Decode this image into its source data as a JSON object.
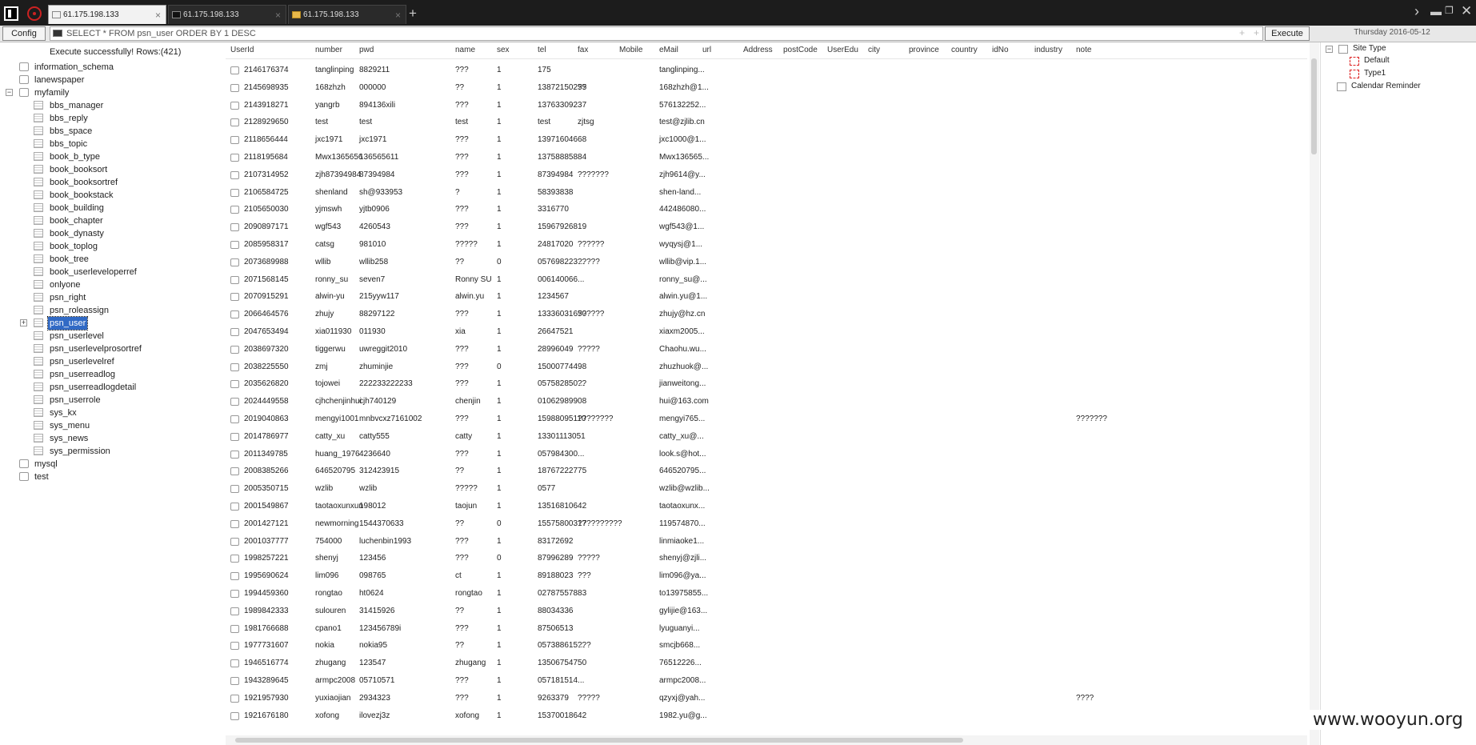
{
  "tabs": [
    {
      "label": "61.175.198.133",
      "active": true,
      "icon": "document-icon"
    },
    {
      "label": "61.175.198.133",
      "active": false,
      "icon": "terminal-icon"
    },
    {
      "label": "61.175.198.133",
      "active": false,
      "icon": "folder-icon"
    }
  ],
  "tab_close": "×",
  "tab_add": "+",
  "window": {
    "chevron": "›",
    "minimize": "▬",
    "maximize": "❐",
    "close": "✕"
  },
  "toolbar": {
    "config_label": "Config",
    "sql": "SELECT * FROM psn_user ORDER BY 1 DESC",
    "plus_label": "+",
    "execute_label": "Execute",
    "date": "Thursday 2016-05-12"
  },
  "status": "Execute successfully! Rows:(421)",
  "tree": {
    "databases_before": [
      "information_schema",
      "lanewspaper"
    ],
    "expanded_db": "myfamily",
    "tables": [
      "bbs_manager",
      "bbs_reply",
      "bbs_space",
      "bbs_topic",
      "book_b_type",
      "book_booksort",
      "book_booksortref",
      "book_bookstack",
      "book_building",
      "book_chapter",
      "book_dynasty",
      "book_toplog",
      "book_tree",
      "book_userleveloperref",
      "onlyone",
      "psn_right",
      "psn_roleassign",
      "psn_user",
      "psn_userlevel",
      "psn_userlevelprosortref",
      "psn_userlevelref",
      "psn_userreadlog",
      "psn_userreadlogdetail",
      "psn_userrole",
      "sys_kx",
      "sys_menu",
      "sys_news",
      "sys_permission"
    ],
    "selected_table": "psn_user",
    "databases_after": [
      "mysql",
      "test"
    ]
  },
  "grid": {
    "columns": [
      "UserId",
      "number",
      "pwd",
      "name",
      "sex",
      "tel",
      "fax",
      "Mobile",
      "eMail",
      "url",
      "Address",
      "postCode",
      "UserEdu",
      "city",
      "province",
      "country",
      "idNo",
      "industry",
      "note"
    ],
    "rows": [
      [
        "2146176374",
        "tanglinping",
        "8829211",
        "???",
        "1",
        "175",
        "",
        "",
        "tanglinping...",
        "",
        "",
        "",
        "",
        "",
        "",
        "",
        "",
        "",
        ""
      ],
      [
        "2145698935",
        "168zhzh",
        "000000",
        "??",
        "1",
        "13872150255",
        "??",
        "",
        "168zhzh@1...",
        "",
        "",
        "",
        "",
        "",
        "",
        "",
        "",
        "",
        ""
      ],
      [
        "2143918271",
        "yangrb",
        "894136xili",
        "???",
        "1",
        "13763309237",
        "",
        "",
        "576132252...",
        "",
        "",
        "",
        "",
        "",
        "",
        "",
        "",
        "",
        ""
      ],
      [
        "2128929650",
        "test",
        "test",
        "test",
        "1",
        "test",
        "zjtsg",
        "",
        "test@zjlib.cn",
        "",
        "",
        "",
        "",
        "",
        "",
        "",
        "",
        "",
        ""
      ],
      [
        "2118656444",
        "jxc1971",
        "jxc1971",
        "???",
        "1",
        "13971604668",
        "",
        "",
        "jxc1000@1...",
        "",
        "",
        "",
        "",
        "",
        "",
        "",
        "",
        "",
        ""
      ],
      [
        "2118195684",
        "Mwx1365656",
        "136565611",
        "???",
        "1",
        "13758885884",
        "",
        "",
        "Mwx136565...",
        "",
        "",
        "",
        "",
        "",
        "",
        "",
        "",
        "",
        ""
      ],
      [
        "2107314952",
        "zjh87394984",
        "87394984",
        "???",
        "1",
        "87394984",
        "???????",
        "",
        "zjh9614@y...",
        "",
        "",
        "",
        "",
        "",
        "",
        "",
        "",
        "",
        ""
      ],
      [
        "2106584725",
        "shenland",
        "sh@933953",
        "?",
        "1",
        "58393838",
        "",
        "",
        "shen-land...",
        "",
        "",
        "",
        "",
        "",
        "",
        "",
        "",
        "",
        ""
      ],
      [
        "2105650030",
        "yjmswh",
        "yjtb0906",
        "???",
        "1",
        "3316770",
        "",
        "",
        "442486080...",
        "",
        "",
        "",
        "",
        "",
        "",
        "",
        "",
        "",
        ""
      ],
      [
        "2090897171",
        "wgf543",
        "4260543",
        "???",
        "1",
        "15967926819",
        "",
        "",
        "wgf543@1...",
        "",
        "",
        "",
        "",
        "",
        "",
        "",
        "",
        "",
        ""
      ],
      [
        "2085958317",
        "catsg",
        "981010",
        "?????",
        "1",
        "24817020",
        "??????",
        "",
        "wyqysj@1...",
        "",
        "",
        "",
        "",
        "",
        "",
        "",
        "",
        "",
        ""
      ],
      [
        "2073689988",
        "wllib",
        "wllib258",
        "??",
        "0",
        "057698223...",
        "?????",
        "",
        "wllib@vip.1...",
        "",
        "",
        "",
        "",
        "",
        "",
        "",
        "",
        "",
        ""
      ],
      [
        "2071568145",
        "ronny_su",
        "seven7",
        "Ronny SU",
        "1",
        "006140066...",
        "",
        "",
        "ronny_su@...",
        "",
        "",
        "",
        "",
        "",
        "",
        "",
        "",
        "",
        ""
      ],
      [
        "2070915291",
        "alwin-yu",
        "215yyw117",
        "alwin.yu",
        "1",
        "1234567",
        "",
        "",
        "alwin.yu@1...",
        "",
        "",
        "",
        "",
        "",
        "",
        "",
        "",
        "",
        ""
      ],
      [
        "2066464576",
        "zhujy",
        "88297122",
        "???",
        "1",
        "13336031650",
        "??????",
        "",
        "zhujy@hz.cn",
        "",
        "",
        "",
        "",
        "",
        "",
        "",
        "",
        "",
        ""
      ],
      [
        "2047653494",
        "xia011930",
        "011930",
        "xia",
        "1",
        "26647521",
        "",
        "",
        "xiaxm2005...",
        "",
        "",
        "",
        "",
        "",
        "",
        "",
        "",
        "",
        ""
      ],
      [
        "2038697320",
        "tiggerwu",
        "uwreggit2010",
        "???",
        "1",
        "28996049",
        "?????",
        "",
        "Chaohu.wu...",
        "",
        "",
        "",
        "",
        "",
        "",
        "",
        "",
        "",
        ""
      ],
      [
        "2038225550",
        "zmj",
        "zhuminjie",
        "???",
        "0",
        "15000774498",
        "",
        "",
        "zhuzhuok@...",
        "",
        "",
        "",
        "",
        "",
        "",
        "",
        "",
        "",
        ""
      ],
      [
        "2035626820",
        "tojowei",
        "222233222233",
        "???",
        "1",
        "057582850...",
        "??",
        "",
        "jianweitong...",
        "",
        "",
        "",
        "",
        "",
        "",
        "",
        "",
        "",
        ""
      ],
      [
        "2024449558",
        "cjhchenjinhui",
        "cjh740129",
        "chenjin",
        "1",
        "01062989908",
        "",
        "",
        "hui@163.com",
        "",
        "",
        "",
        "",
        "",
        "",
        "",
        "",
        "",
        ""
      ],
      [
        "2019040863",
        "mengyi1001",
        "mnbvcxz7161002",
        "???",
        "1",
        "15988095110",
        "????????",
        "",
        "mengyi765...",
        "",
        "",
        "",
        "",
        "",
        "",
        "",
        "",
        "",
        "???????"
      ],
      [
        "2014786977",
        "catty_xu",
        "catty555",
        "catty",
        "1",
        "13301113051",
        "",
        "",
        "catty_xu@...",
        "",
        "",
        "",
        "",
        "",
        "",
        "",
        "",
        "",
        ""
      ],
      [
        "2011349785",
        "huang_1976",
        "4236640",
        "???",
        "1",
        "057984300...",
        "",
        "",
        "look.s@hot...",
        "",
        "",
        "",
        "",
        "",
        "",
        "",
        "",
        "",
        ""
      ],
      [
        "2008385266",
        "646520795",
        "312423915",
        "??",
        "1",
        "18767222775",
        "",
        "",
        "646520795...",
        "",
        "",
        "",
        "",
        "",
        "",
        "",
        "",
        "",
        ""
      ],
      [
        "2005350715",
        "wzlib",
        "wzlib",
        "?????",
        "1",
        "0577",
        "",
        "",
        "wzlib@wzlib...",
        "",
        "",
        "",
        "",
        "",
        "",
        "",
        "",
        "",
        ""
      ],
      [
        "2001549867",
        "taotaoxunxun",
        "198012",
        "taojun",
        "1",
        "13516810642",
        "",
        "",
        "taotaoxunx...",
        "",
        "",
        "",
        "",
        "",
        "",
        "",
        "",
        "",
        ""
      ],
      [
        "2001427121",
        "newmorning",
        "1544370633",
        "??",
        "0",
        "15575800317",
        "??????????",
        "",
        "119574870...",
        "",
        "",
        "",
        "",
        "",
        "",
        "",
        "",
        "",
        ""
      ],
      [
        "2001037777",
        "754000",
        "luchenbin1993",
        "???",
        "1",
        "83172692",
        "",
        "",
        "linmiaoke1...",
        "",
        "",
        "",
        "",
        "",
        "",
        "",
        "",
        "",
        ""
      ],
      [
        "1998257221",
        "shenyj",
        "123456",
        "???",
        "0",
        "87996289",
        "?????",
        "",
        "shenyj@zjli...",
        "",
        "",
        "",
        "",
        "",
        "",
        "",
        "",
        "",
        ""
      ],
      [
        "1995690624",
        "lim096",
        "098765",
        "ct",
        "1",
        "89188023",
        "???",
        "",
        "lim096@ya...",
        "",
        "",
        "",
        "",
        "",
        "",
        "",
        "",
        "",
        ""
      ],
      [
        "1994459360",
        "rongtao",
        "ht0624",
        "rongtao",
        "1",
        "02787557883",
        "",
        "",
        "to13975855...",
        "",
        "",
        "",
        "",
        "",
        "",
        "",
        "",
        "",
        ""
      ],
      [
        "1989842333",
        "sulouren",
        "31415926",
        "??",
        "1",
        "88034336",
        "",
        "",
        "gylijie@163...",
        "",
        "",
        "",
        "",
        "",
        "",
        "",
        "",
        "",
        ""
      ],
      [
        "1981766688",
        "cpano1",
        "123456789i",
        "???",
        "1",
        "87506513",
        "",
        "",
        "lyuguanyi...",
        "",
        "",
        "",
        "",
        "",
        "",
        "",
        "",
        "",
        ""
      ],
      [
        "1977731607",
        "nokia",
        "nokia95",
        "??",
        "1",
        "057388615...",
        "???",
        "",
        "smcjb668...",
        "",
        "",
        "",
        "",
        "",
        "",
        "",
        "",
        "",
        ""
      ],
      [
        "1946516774",
        "zhugang",
        "123547",
        "zhugang",
        "1",
        "13506754750",
        "",
        "",
        "76512226...",
        "",
        "",
        "",
        "",
        "",
        "",
        "",
        "",
        "",
        ""
      ],
      [
        "1943289645",
        "armpc2008",
        "05710571",
        "???",
        "1",
        "057181514...",
        "",
        "",
        "armpc2008...",
        "",
        "",
        "",
        "",
        "",
        "",
        "",
        "",
        "",
        ""
      ],
      [
        "1921957930",
        "yuxiaojian",
        "2934323",
        "???",
        "1",
        "9263379",
        "?????",
        "",
        "qzyxj@yah...",
        "",
        "",
        "",
        "",
        "",
        "",
        "",
        "",
        "",
        "????"
      ],
      [
        "1921676180",
        "xofong",
        "ilovezj3z",
        "xofong",
        "1",
        "15370018642",
        "",
        "",
        "1982.yu@g...",
        "",
        "",
        "",
        "",
        "",
        "",
        "",
        "",
        "",
        ""
      ]
    ]
  },
  "right_panel": {
    "root_label": "Site Type",
    "children": [
      "Default",
      "Type1"
    ],
    "reminder_label": "Calendar Reminder",
    "collapse_glyph": "−"
  },
  "tree_glyphs": {
    "expanded": "−",
    "collapsed": "+"
  },
  "watermark": "www.wooyun.org"
}
